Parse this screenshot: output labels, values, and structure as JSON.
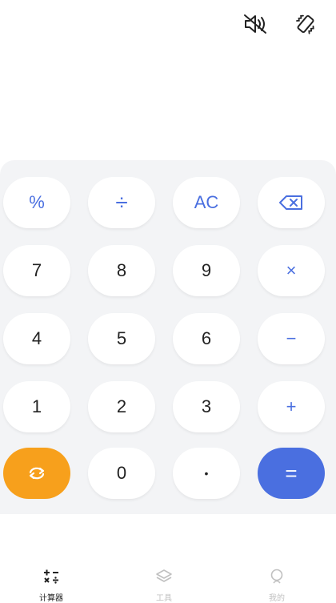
{
  "header": {
    "sound_icon": "speaker-muted-icon",
    "vibrate_icon": "vibrate-phone-icon"
  },
  "keypad": {
    "row1": [
      "%",
      "÷",
      "AC"
    ],
    "backspace_icon": "backspace-icon",
    "row2": [
      "7",
      "8",
      "9",
      "×"
    ],
    "row3": [
      "4",
      "5",
      "6",
      "−"
    ],
    "row4": [
      "1",
      "2",
      "3",
      "+"
    ],
    "row5": [
      "0",
      "•",
      "="
    ],
    "swap_icon": "refresh-swap-icon"
  },
  "colors": {
    "accent_blue": "#4a6fe0",
    "accent_orange": "#f7a01c",
    "keypad_background": "#f3f4f6"
  },
  "tabs": [
    {
      "label": "计算器",
      "icon": "calculator-ops-icon",
      "active": true
    },
    {
      "label": "工具",
      "icon": "layers-icon",
      "active": false
    },
    {
      "label": "我的",
      "icon": "profile-icon",
      "active": false
    }
  ]
}
